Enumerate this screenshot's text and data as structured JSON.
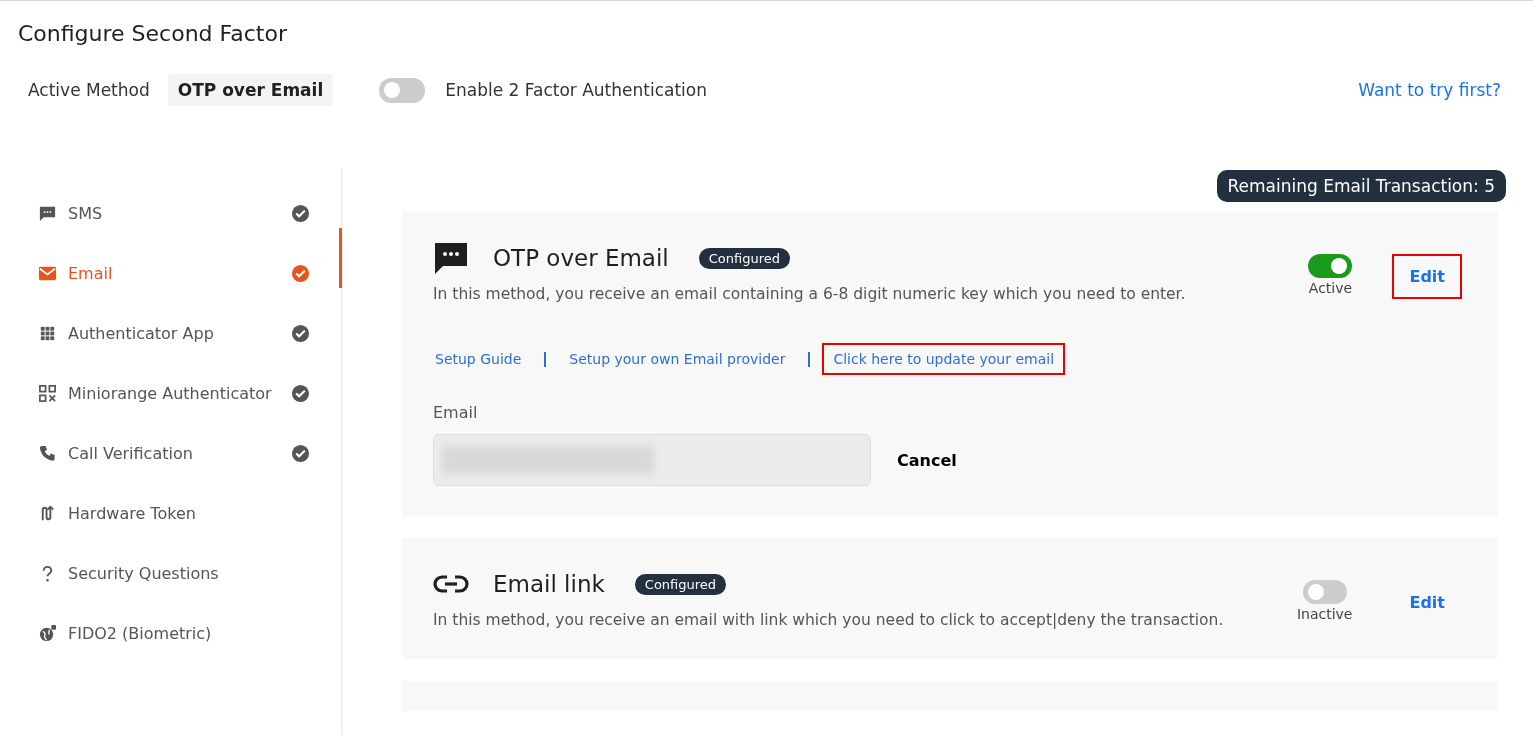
{
  "title": "Configure Second Factor",
  "active_method": {
    "label": "Active Method",
    "value": "OTP over Email"
  },
  "enable_2fa": {
    "label": "Enable 2 Factor Authentication",
    "on": false
  },
  "try_link": "Want to try first?",
  "sidebar": {
    "items": [
      {
        "label": "SMS",
        "selected": false,
        "configured": true
      },
      {
        "label": "Email",
        "selected": true,
        "configured": true
      },
      {
        "label": "Authenticator App",
        "selected": false,
        "configured": true
      },
      {
        "label": "Miniorange Authenticator",
        "selected": false,
        "configured": true
      },
      {
        "label": "Call Verification",
        "selected": false,
        "configured": true
      },
      {
        "label": "Hardware Token",
        "selected": false,
        "configured": false
      },
      {
        "label": "Security Questions",
        "selected": false,
        "configured": false
      },
      {
        "label": "FIDO2 (Biometric)",
        "selected": false,
        "configured": false
      }
    ]
  },
  "remaining_badge": "Remaining Email Transaction: 5",
  "methods": [
    {
      "title": "OTP over Email",
      "badge": "Configured",
      "description": "In this method, you receive an email containing a 6-8 digit numeric key which you need to enter.",
      "on": true,
      "status": "Active",
      "edit": "Edit",
      "edit_highlighted": true,
      "links": [
        {
          "label": "Setup Guide",
          "highlighted": false
        },
        {
          "label": "Setup your own Email provider",
          "highlighted": false
        },
        {
          "label": "Click here to update your email",
          "highlighted": true
        }
      ],
      "email_field": {
        "label": "Email",
        "redacted": true
      },
      "cancel": "Cancel"
    },
    {
      "title": "Email link",
      "badge": "Configured",
      "description": "In this method, you receive an email with link which you need to click to accept|deny the transaction.",
      "on": false,
      "status": "Inactive",
      "edit": "Edit",
      "edit_highlighted": false
    }
  ]
}
